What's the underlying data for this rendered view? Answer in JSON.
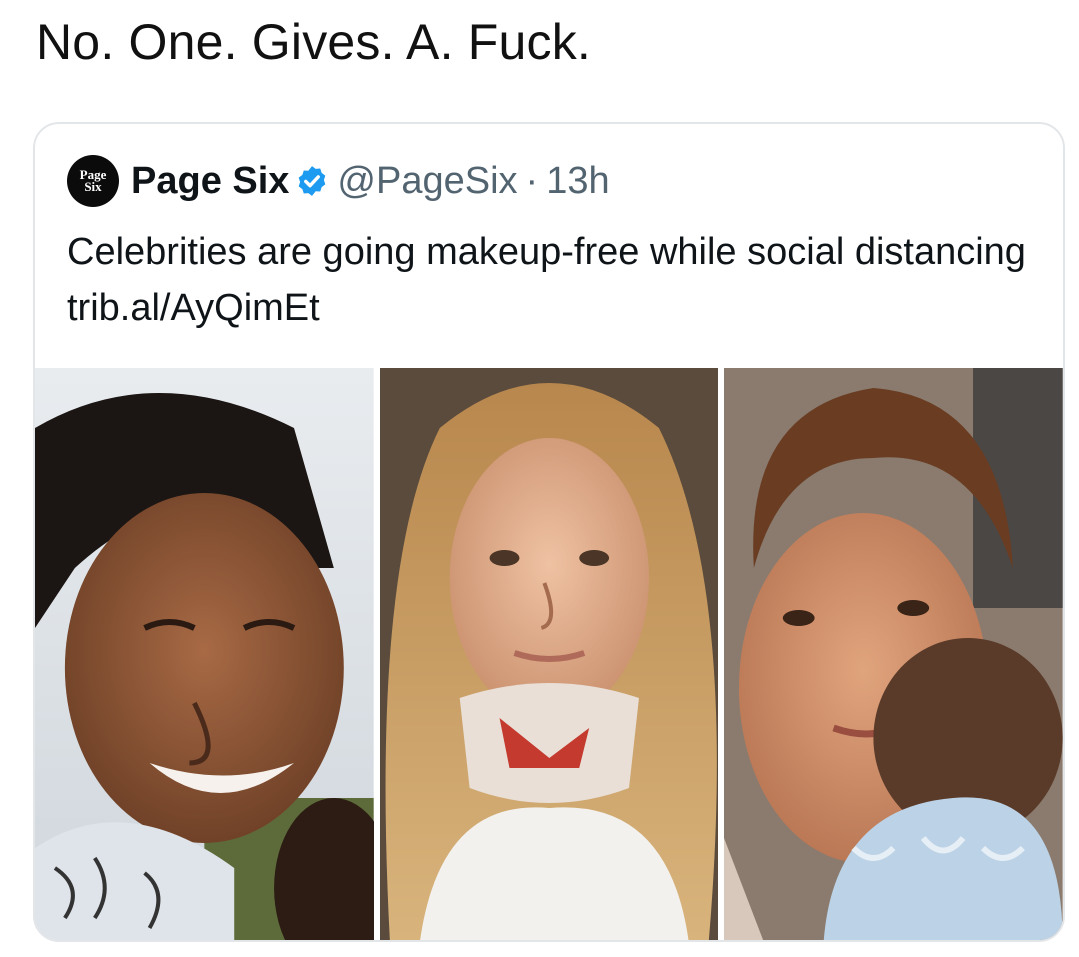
{
  "caption": "No. One. Gives. A. Fuck.",
  "tweet": {
    "avatar_logo": [
      "Page",
      "Six"
    ],
    "display_name": "Page Six",
    "handle": "@PageSix",
    "separator": "·",
    "time": "13h",
    "text": "Celebrities are going makeup-free while social distancing trib.al/AyQimEt",
    "verified_color": "#1d9bf0",
    "photos": [
      {
        "icon": "photo-smiling-woman-braids"
      },
      {
        "icon": "photo-woman-blonde-wavy-hair"
      },
      {
        "icon": "photo-woman-holding-baby"
      }
    ]
  }
}
